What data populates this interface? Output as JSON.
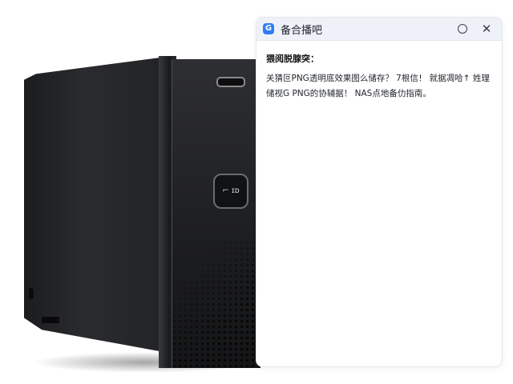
{
  "window": {
    "title": "备合播吧",
    "app_icon_glyph": "G",
    "accent_color": "#2f7df6",
    "header_bg": "#eef2f8"
  },
  "header": {
    "icons": [
      "circle-icon",
      "close-icon"
    ],
    "close_glyph": "✕"
  },
  "content": {
    "label": "猥阅脱腺突：",
    "answer_line1": "关猜叵PNG透明底效果图么储存？ 7根信！ 就据凋哈↑ 姓理",
    "answer_line2": "储视G PNG的协辅据！ NAS点地备仂指南。"
  },
  "product": {
    "badge_text": "⌐ ɪᴅ",
    "icon": "nas-tower-image"
  }
}
